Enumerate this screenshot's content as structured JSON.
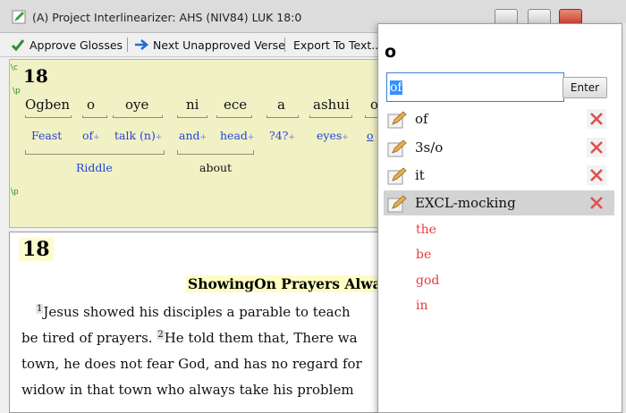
{
  "window": {
    "title": "(A) Project Interlinearizer: AHS (NIV84) LUK 18:0"
  },
  "toolbar": {
    "approve_label": "Approve Glosses",
    "next_label": "Next Unapproved Verse",
    "export_label": "Export To Text..."
  },
  "interlinear": {
    "verse_number": "18",
    "words": [
      "Ogben",
      "o",
      "oye",
      "ni",
      "ece",
      "a",
      "ashui",
      "o"
    ],
    "glosses": [
      "Feast",
      "of",
      "talk (n)",
      "and",
      "head",
      "?4?",
      "eyes",
      "o"
    ],
    "plus_sign": "+",
    "phrases": {
      "riddle": "Riddle",
      "about": "about"
    },
    "colors": {
      "background": "#f1f1c6",
      "gloss": "#2244d4",
      "marker": "#2f8a2f"
    }
  },
  "text_pane": {
    "chapter": "18",
    "heading": "ShowingOn Prayers Alwa",
    "lines": [
      {
        "verse": "1",
        "text": "Jesus showed his disciples a parable to teach "
      },
      {
        "pre": "be tired of prayers. ",
        "verse": "2",
        "text": "He told them that, There wa"
      },
      {
        "text": "town, he does not fear God, and has no regard for"
      },
      {
        "text": "widow in that town who always take his problem"
      }
    ]
  },
  "popup": {
    "source_word": "o",
    "input_value": "of",
    "enter_label": "Enter",
    "options": [
      {
        "label": "of",
        "selected": false
      },
      {
        "label": "3s/o",
        "selected": false
      },
      {
        "label": "it",
        "selected": false
      },
      {
        "label": "EXCL-mocking",
        "selected": true
      }
    ],
    "suggestions": [
      "the",
      "be",
      "god",
      "in"
    ],
    "colors": {
      "selection": "#d3d3d3",
      "suggestion": "#e04040",
      "delete": "#e05050"
    }
  }
}
